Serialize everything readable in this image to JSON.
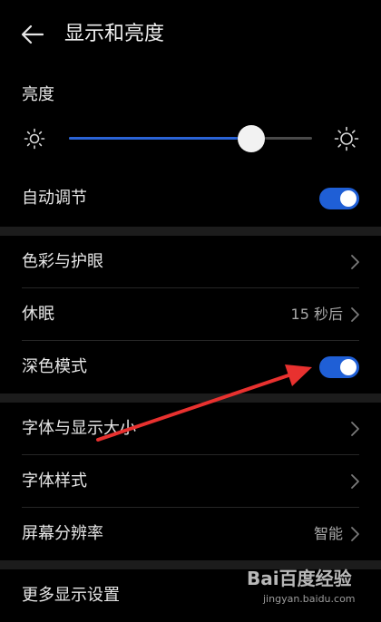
{
  "header": {
    "back_icon": "arrow-left-icon",
    "title": "显示和亮度"
  },
  "brightness": {
    "label": "亮度",
    "level_percent": 75,
    "min_icon": "sun-small-icon",
    "max_icon": "sun-large-icon",
    "accent": "#2a63d6"
  },
  "rows": {
    "auto_adjust": {
      "label": "自动调节",
      "toggle_on": true
    },
    "color_eye": {
      "label": "色彩与护眼"
    },
    "sleep": {
      "label": "休眠",
      "value": "15 秒后"
    },
    "dark_mode": {
      "label": "深色模式",
      "toggle_on": true
    },
    "font_display_size": {
      "label": "字体与显示大小"
    },
    "font_style": {
      "label": "字体样式"
    },
    "resolution": {
      "label": "屏幕分辨率",
      "value": "智能"
    },
    "more_settings": {
      "label": "更多显示设置"
    }
  },
  "annotation": {
    "color": "#e8312f",
    "icon": "red-arrow-annotation"
  },
  "watermark": {
    "logo": "Bai百度经验",
    "url": "jingyan.baidu.com"
  }
}
